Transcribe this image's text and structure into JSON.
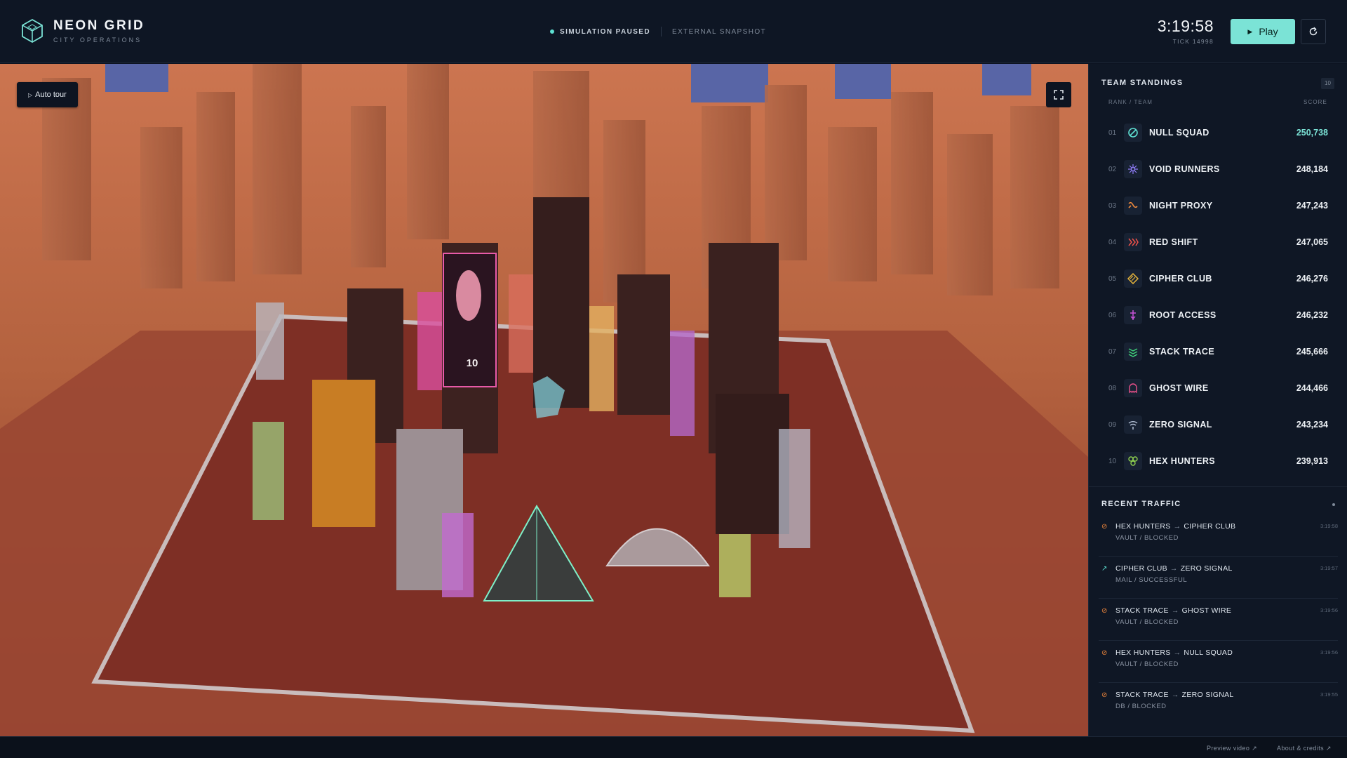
{
  "header": {
    "title": "NEON GRID",
    "subtitle": "CITY OPERATIONS",
    "status": "SIMULATION PAUSED",
    "snapshot": "EXTERNAL SNAPSHOT",
    "time": "3:19:58",
    "tick": "TICK 14998",
    "play_label": "Play",
    "logo_icon": "hexagon-cube-icon",
    "reset_icon": "refresh-icon"
  },
  "scene": {
    "auto_tour_label": "Auto tour",
    "fullscreen_icon": "fullscreen-icon",
    "billboard_number": "10"
  },
  "standings": {
    "heading": "TEAM STANDINGS",
    "count": "10",
    "col_rank": "RANK / TEAM",
    "col_score": "SCORE",
    "teams": [
      {
        "rank": "01",
        "name": "NULL SQUAD",
        "score": "250,738",
        "icon": "slashed-circle-icon",
        "color": "#5ee0d2"
      },
      {
        "rank": "02",
        "name": "VOID RUNNERS",
        "score": "248,184",
        "icon": "starburst-icon",
        "color": "#8e7bf5"
      },
      {
        "rank": "03",
        "name": "NIGHT PROXY",
        "score": "247,243",
        "icon": "proxy-icon",
        "color": "#f08a3c"
      },
      {
        "rank": "04",
        "name": "RED SHIFT",
        "score": "247,065",
        "icon": "chevrons-icon",
        "color": "#f0524a"
      },
      {
        "rank": "05",
        "name": "CIPHER CLUB",
        "score": "246,276",
        "icon": "cipher-diamond-icon",
        "color": "#e7b53b"
      },
      {
        "rank": "06",
        "name": "ROOT ACCESS",
        "score": "246,232",
        "icon": "root-icon",
        "color": "#c653d8"
      },
      {
        "rank": "07",
        "name": "STACK TRACE",
        "score": "245,666",
        "icon": "stack-icon",
        "color": "#3fcf7a"
      },
      {
        "rank": "08",
        "name": "GHOST WIRE",
        "score": "244,466",
        "icon": "ghost-icon",
        "color": "#e8508a"
      },
      {
        "rank": "09",
        "name": "ZERO SIGNAL",
        "score": "243,234",
        "icon": "signal-icon",
        "color": "#aebbd0"
      },
      {
        "rank": "10",
        "name": "HEX HUNTERS",
        "score": "239,913",
        "icon": "hex-cluster-icon",
        "color": "#8fd14f"
      }
    ]
  },
  "traffic": {
    "heading": "RECENT TRAFFIC",
    "items": [
      {
        "from": "HEX HUNTERS",
        "to": "CIPHER CLUB",
        "detail": "VAULT / BLOCKED",
        "time": "3:19:58",
        "status": "blocked",
        "icon": "blocked-icon"
      },
      {
        "from": "CIPHER CLUB",
        "to": "ZERO SIGNAL",
        "detail": "MAIL / SUCCESSFUL",
        "time": "3:19:57",
        "status": "success",
        "icon": "arrow-up-right-icon"
      },
      {
        "from": "STACK TRACE",
        "to": "GHOST WIRE",
        "detail": "VAULT / BLOCKED",
        "time": "3:19:56",
        "status": "blocked",
        "icon": "blocked-icon"
      },
      {
        "from": "HEX HUNTERS",
        "to": "NULL SQUAD",
        "detail": "VAULT / BLOCKED",
        "time": "3:19:56",
        "status": "blocked",
        "icon": "blocked-icon"
      },
      {
        "from": "STACK TRACE",
        "to": "ZERO SIGNAL",
        "detail": "DB / BLOCKED",
        "time": "3:19:55",
        "status": "blocked",
        "icon": "blocked-icon"
      }
    ]
  },
  "footer": {
    "preview_label": "Preview video ↗",
    "about_label": "About & credits ↗"
  },
  "colors": {
    "accent": "#7be3d6",
    "blocked": "#e8833a",
    "success": "#5ee0d2",
    "background": "#0e1624"
  }
}
